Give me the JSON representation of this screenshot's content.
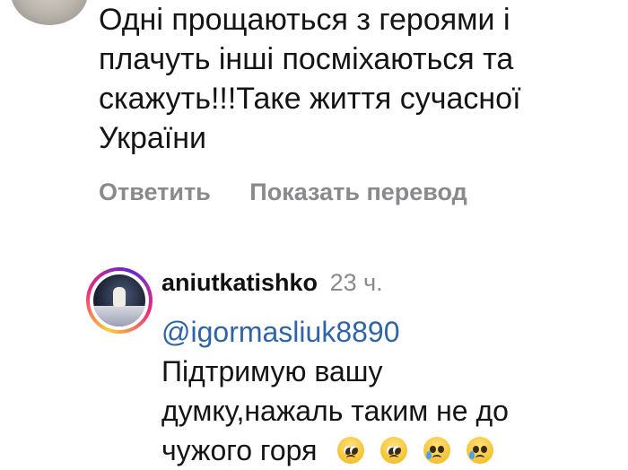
{
  "comment": {
    "lines": [
      "Одні прощаються з героями і",
      "плачуть інші посміхаються та",
      "скажуть!!!Таке життя сучасної",
      "України"
    ]
  },
  "actions": {
    "reply_label": "Ответить",
    "translate_label": "Показать перевод"
  },
  "reply": {
    "username": "aniutkatishko",
    "time": "23 ч.",
    "mention": "@igormasliuk8890",
    "lines": [
      "Підтримую вашу",
      "думку,нажаль таким не до",
      "чужого горя"
    ],
    "emojis": [
      "pleading-face",
      "pleading-face",
      "sad-but-relieved-face",
      "sad-but-relieved-face"
    ]
  }
}
